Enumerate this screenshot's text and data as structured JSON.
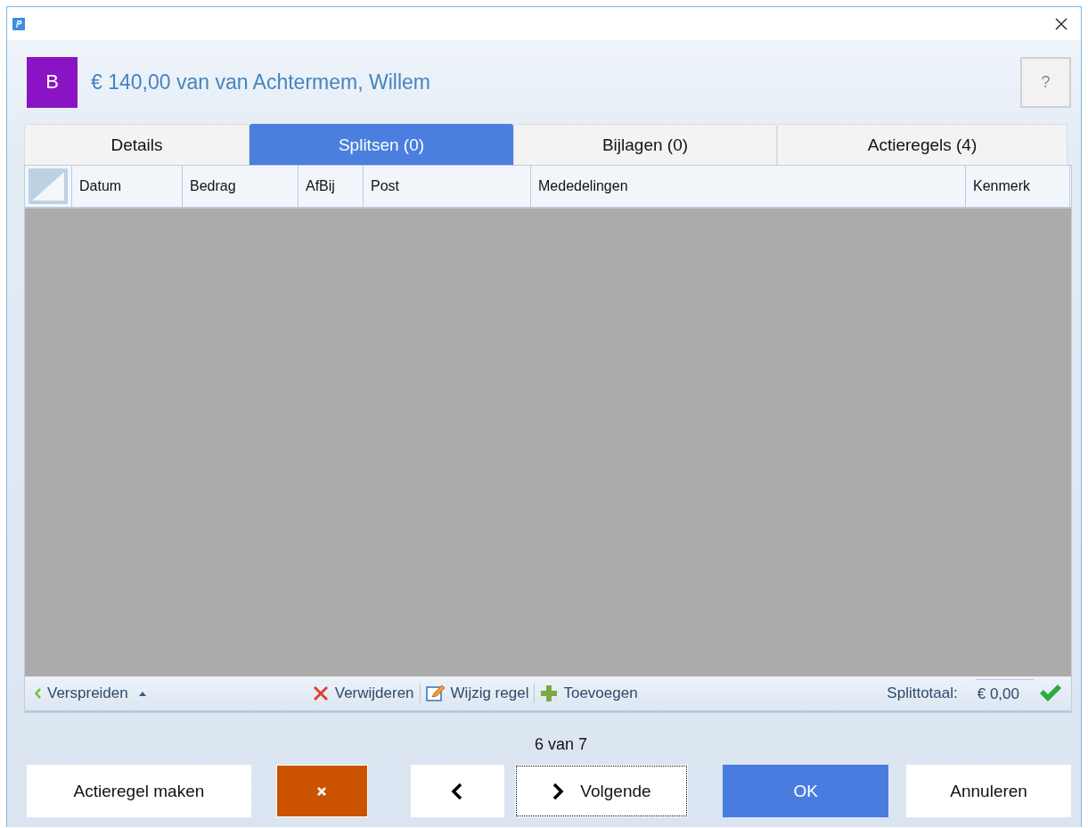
{
  "header": {
    "avatar_letter": "B",
    "title": "€ 140,00 van van Achtermem, Willem",
    "help": "?"
  },
  "tabs": [
    {
      "label": "Details",
      "selected": false
    },
    {
      "label": "Splitsen (0)",
      "selected": true
    },
    {
      "label": "Bijlagen (0)",
      "selected": false
    },
    {
      "label": "Actieregels (4)",
      "selected": false
    }
  ],
  "table": {
    "columns": [
      "Datum",
      "Bedrag",
      "AfBij",
      "Post",
      "Mededelingen",
      "Kenmerk"
    ]
  },
  "toolbar": {
    "spread": "Verspreiden",
    "actions": [
      {
        "kind": "delete",
        "label": "Verwijderen"
      },
      {
        "kind": "edit",
        "label": "Wijzig regel"
      },
      {
        "kind": "add",
        "label": "Toevoegen"
      }
    ],
    "total_label": "Splittotaal:",
    "total_value": "€ 0,00"
  },
  "counter": "6 van 7",
  "buttons": [
    {
      "kind": "text",
      "label": "Actieregel maken"
    },
    {
      "kind": "discard"
    },
    {
      "kind": "prev"
    },
    {
      "kind": "next",
      "label": "Volgende"
    },
    {
      "kind": "primary",
      "label": "OK"
    },
    {
      "kind": "text",
      "label": "Annuleren"
    }
  ]
}
